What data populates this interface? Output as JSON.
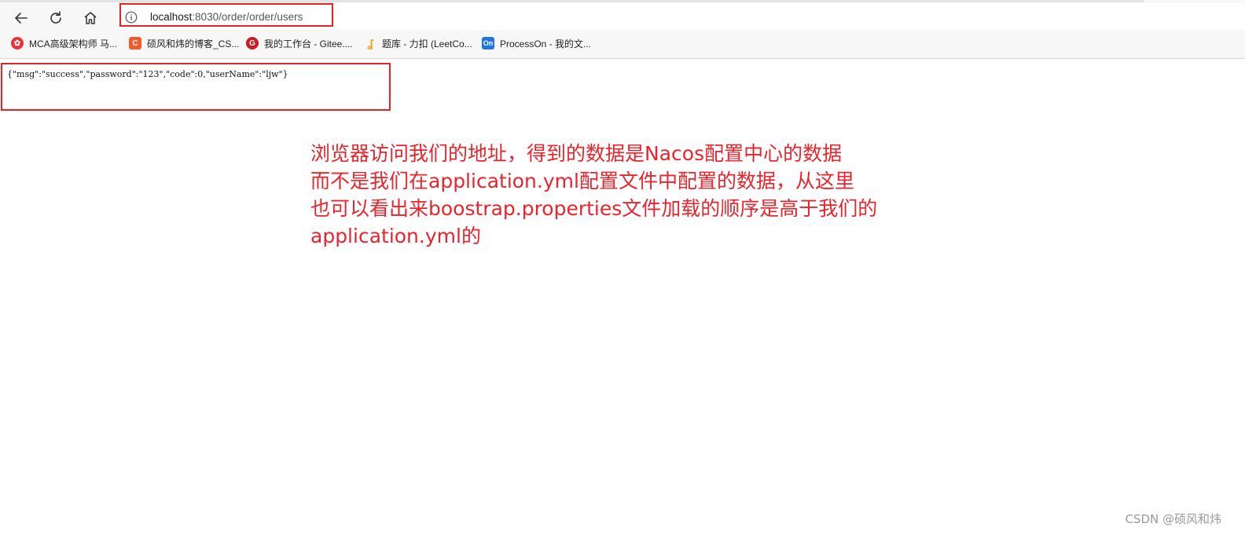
{
  "browser": {
    "url_host": "localhost",
    "url_rest": ":8030/order/order/users",
    "bookmarks": [
      {
        "label": "MCA高级架构师 马...",
        "icon": "mca-favicon",
        "color": "#e8333a"
      },
      {
        "label": "硕风和炜的博客_CS...",
        "icon": "csdn-favicon",
        "color": "#f25a29"
      },
      {
        "label": "我的工作台 - Gitee....",
        "icon": "gitee-favicon",
        "color": "#c71d23"
      },
      {
        "label": "题库 - 力扣 (LeetCo...",
        "icon": "leetcode-favicon",
        "color": "#f0a020"
      },
      {
        "label": "ProcessOn - 我的文...",
        "icon": "processon-favicon",
        "color": "#1e74e8"
      }
    ]
  },
  "page": {
    "json_response": "{\"msg\":\"success\",\"password\":\"123\",\"code\":0,\"userName\":\"ljw\"}"
  },
  "annotation": {
    "lines": [
      "浏览器访问我们的地址，得到的数据是Nacos配置中心的数据",
      "而不是我们在application.yml配置文件中配置的数据，从这里",
      "也可以看出来boostrap.properties文件加载的顺序是高于我们的",
      "application.yml的"
    ],
    "color": "#e8242c"
  },
  "watermark": "CSDN @硕风和炜"
}
